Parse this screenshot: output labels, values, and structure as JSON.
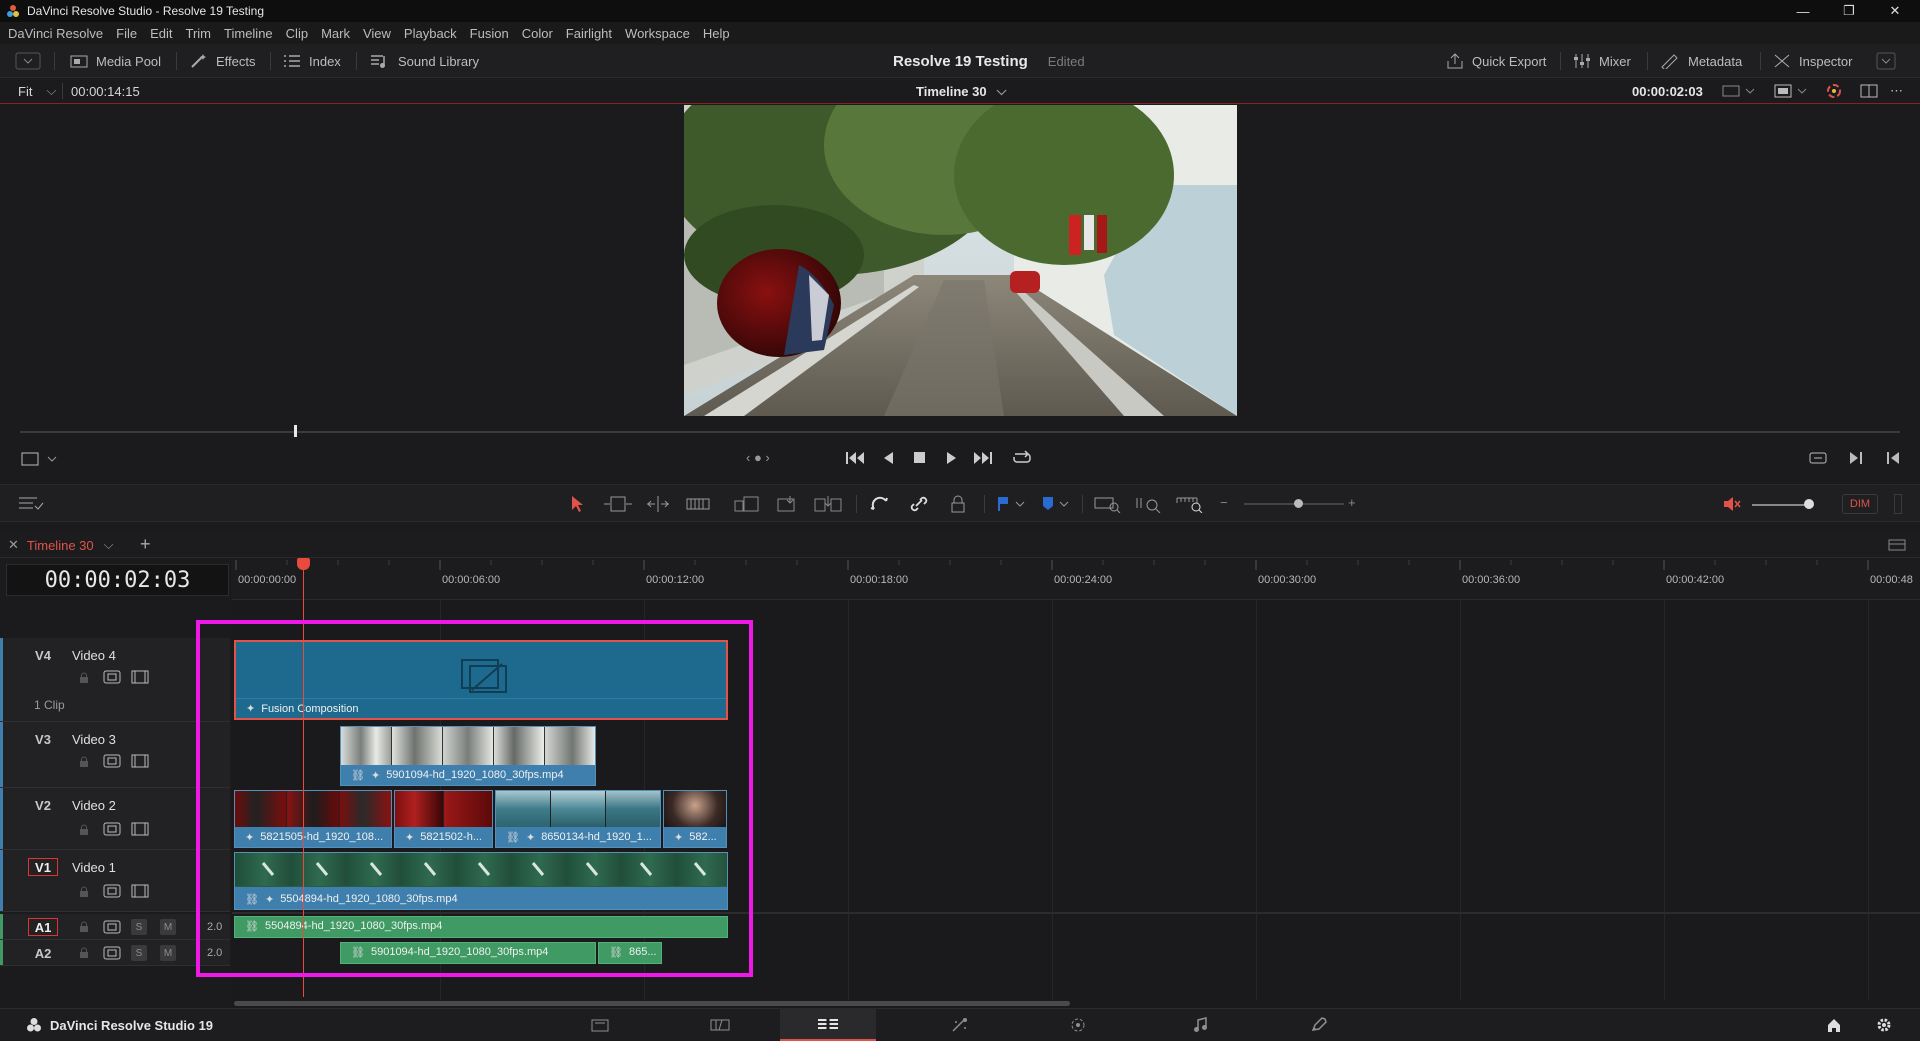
{
  "window": {
    "title": "DaVinci Resolve Studio - Resolve 19 Testing",
    "minimize": "—",
    "restore": "❐",
    "close": "✕"
  },
  "menu": [
    "DaVinci Resolve",
    "File",
    "Edit",
    "Trim",
    "Timeline",
    "Clip",
    "Mark",
    "View",
    "Playback",
    "Fusion",
    "Color",
    "Fairlight",
    "Workspace",
    "Help"
  ],
  "toolbar": {
    "media_pool": "Media Pool",
    "effects": "Effects",
    "index": "Index",
    "sound_library": "Sound Library",
    "project_name": "Resolve 19 Testing",
    "project_status": "Edited",
    "quick_export": "Quick Export",
    "mixer": "Mixer",
    "metadata": "Metadata",
    "inspector": "Inspector"
  },
  "viewer": {
    "zoom": "Fit",
    "duration": "00:00:14:15",
    "timeline_name": "Timeline 30",
    "timecode": "00:00:02:03"
  },
  "audio": {
    "dim": "DIM"
  },
  "timeline": {
    "tab_name": "Timeline 30",
    "tab_close": "✕",
    "tab_add": "+",
    "timecode": "00:00:02:03",
    "ruler": [
      "00:00:00:00",
      "00:00:06:00",
      "00:00:12:00",
      "00:00:18:00",
      "00:00:24:00",
      "00:00:30:00",
      "00:00:36:00",
      "00:00:42:00",
      "00:00:48"
    ],
    "tracks": {
      "v4": {
        "code": "V4",
        "name": "Video 4",
        "clips": "1 Clip"
      },
      "v3": {
        "code": "V3",
        "name": "Video 3"
      },
      "v2": {
        "code": "V2",
        "name": "Video 2"
      },
      "v1": {
        "code": "V1",
        "name": "Video 1"
      },
      "a1": {
        "code": "A1",
        "level": "2.0",
        "solo": "S",
        "mute": "M"
      },
      "a2": {
        "code": "A2",
        "level": "2.0",
        "solo": "S",
        "mute": "M"
      }
    },
    "clips": {
      "fusion": "Fusion Composition",
      "v3": "5901094-hd_1920_1080_30fps.mp4",
      "v2a": "5821505-hd_1920_108...",
      "v2b": "5821502-h...",
      "v2c": "8650134-hd_1920_1...",
      "v2d": "582...",
      "v1": "5504894-hd_1920_1080_30fps.mp4",
      "a1": "5504894-hd_1920_1080_30fps.mp4",
      "a2a": "5901094-hd_1920_1080_30fps.mp4",
      "a2b": "865..."
    }
  },
  "pagebar": {
    "brand": "DaVinci Resolve Studio 19"
  },
  "colors": {
    "accent_red": "#e0534a",
    "highlight": "#ee19e8",
    "video_clip": "#3f7fad",
    "audio_clip": "#3f9a64",
    "fusion_clip": "#1e6a8e"
  }
}
